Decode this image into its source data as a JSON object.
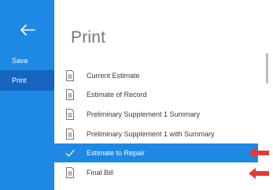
{
  "sidebar": {
    "back_icon": "arrow-left-icon",
    "items": [
      {
        "label": "Save"
      },
      {
        "label": "Print"
      }
    ],
    "bg_color": "#1e88e5",
    "active_color": "#1565c0"
  },
  "main": {
    "title": "Print",
    "options": [
      {
        "label": "Current Estimate",
        "icon": "document-icon",
        "selected": false
      },
      {
        "label": "Estimate of Record",
        "icon": "document-icon",
        "selected": false
      },
      {
        "label": "Preliminary Supplement 1 Summary",
        "icon": "document-icon",
        "selected": false
      },
      {
        "label": "Preliminary Supplement 1 with Summary",
        "icon": "document-icon",
        "selected": false
      },
      {
        "label": "Estimate to Repair",
        "icon": "check-icon",
        "selected": true
      },
      {
        "label": "Final Bill",
        "icon": "document-icon",
        "selected": false
      }
    ],
    "selected_color": "#1e88e5"
  },
  "annotations": {
    "arrow_color": "#e53935",
    "arrow_icon": "red-arrow-left-icon"
  }
}
